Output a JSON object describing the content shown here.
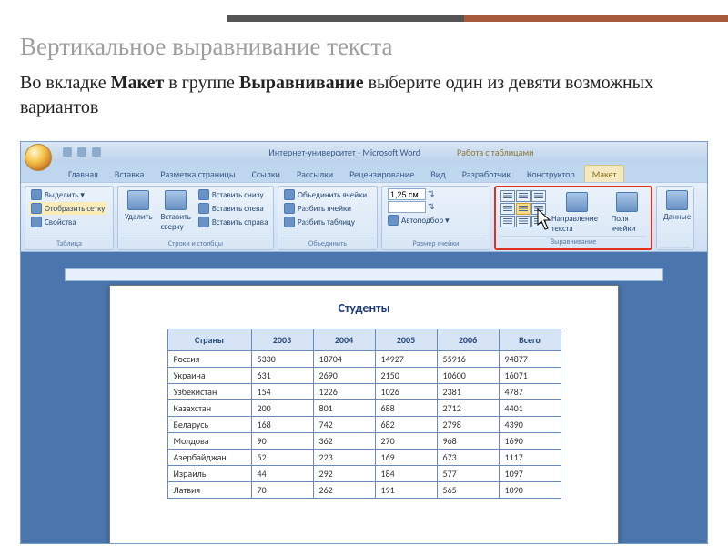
{
  "slide": {
    "title": "Вертикальное выравнивание текста",
    "body_part1": "Во вкладке ",
    "body_bold1": "Макет",
    "body_part2": " в группе ",
    "body_bold2": "Выравнивание",
    "body_part3": " выберите один из девяти возможных вариантов"
  },
  "window": {
    "title": "Интернет-университет - Microsoft Word",
    "context": "Работа с таблицами"
  },
  "tabs": [
    "Главная",
    "Вставка",
    "Разметка страницы",
    "Ссылки",
    "Рассылки",
    "Рецензирование",
    "Вид",
    "Разработчик",
    "Конструктор",
    "Макет"
  ],
  "ribbon": {
    "g_table": {
      "title": "Таблица",
      "select": "Выделить ▾",
      "grid": "Отобразить сетку",
      "props": "Свойства"
    },
    "g_rowscols": {
      "title": "Строки и столбцы",
      "delete": "Удалить",
      "ins_top": "Вставить сверху",
      "ins_bottom": "Вставить снизу",
      "ins_left": "Вставить слева",
      "ins_right": "Вставить справа"
    },
    "g_merge": {
      "title": "Объединить",
      "merge": "Объединить ячейки",
      "split": "Разбить ячейки",
      "split_table": "Разбить таблицу"
    },
    "g_size": {
      "title": "Размер ячейки",
      "h": "1,25 см",
      "w": "",
      "autofit": "Автоподбор ▾"
    },
    "g_align": {
      "title": "Выравнивание",
      "direction": "Направление текста",
      "margins": "Поля ячейки"
    },
    "g_data": {
      "title": "Данные",
      "label": "Данные"
    }
  },
  "doc": {
    "title": "Студенты",
    "headers": [
      "Страны",
      "2003",
      "2004",
      "2005",
      "2006",
      "Всего"
    ],
    "rows": [
      [
        "Россия",
        "5330",
        "18704",
        "14927",
        "55916",
        "94877"
      ],
      [
        "Украина",
        "631",
        "2690",
        "2150",
        "10600",
        "16071"
      ],
      [
        "Узбекистан",
        "154",
        "1226",
        "1026",
        "2381",
        "4787"
      ],
      [
        "Казахстан",
        "200",
        "801",
        "688",
        "2712",
        "4401"
      ],
      [
        "Беларусь",
        "168",
        "742",
        "682",
        "2798",
        "4390"
      ],
      [
        "Молдова",
        "90",
        "362",
        "270",
        "968",
        "1690"
      ],
      [
        "Азербайджан",
        "52",
        "223",
        "169",
        "673",
        "1117"
      ],
      [
        "Израиль",
        "44",
        "292",
        "184",
        "577",
        "1097"
      ],
      [
        "Латвия",
        "70",
        "262",
        "191",
        "565",
        "1090"
      ]
    ]
  }
}
